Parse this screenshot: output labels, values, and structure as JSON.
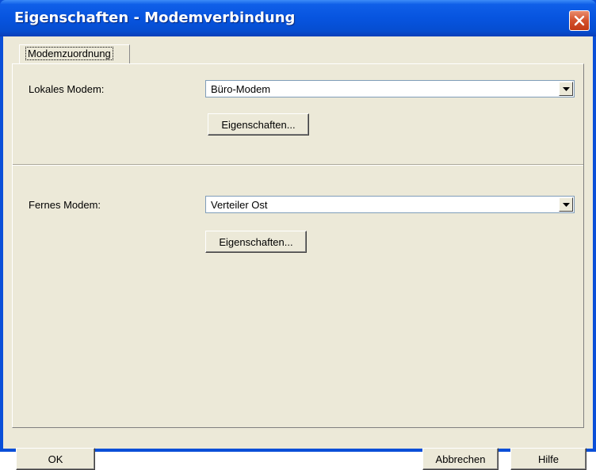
{
  "window": {
    "title": "Eigenschaften - Modemverbindung"
  },
  "tabs": [
    {
      "label": "Modemzuordnung"
    }
  ],
  "local_modem": {
    "label": "Lokales Modem:",
    "value": "Büro-Modem",
    "properties_button": "Eigenschaften..."
  },
  "remote_modem": {
    "label": "Fernes Modem:",
    "value": "Verteiler Ost",
    "properties_button": "Eigenschaften..."
  },
  "footer": {
    "ok": "OK",
    "cancel": "Abbrechen",
    "help": "Hilfe"
  },
  "icons": {
    "close": "close-icon",
    "dropdown": "chevron-down-icon"
  },
  "colors": {
    "titlebar": "#0754df",
    "dialog_bg": "#ece9d8",
    "close": "#d3512c"
  }
}
